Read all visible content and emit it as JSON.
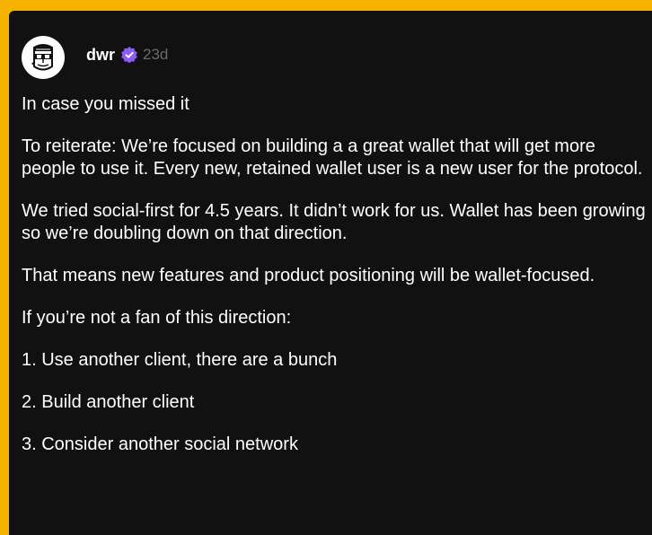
{
  "post": {
    "author": {
      "name": "dwr",
      "verified": true,
      "time": "23d"
    },
    "paragraphs": [
      "In case you missed it",
      "To reiterate: We’re focused on building a a great wallet that will get more people to use it. Every new, retained wallet user is a new user for the protocol.",
      "We tried social-first for 4.5 years. It didn’t work for us. Wallet has been growing so we’re doubling down on that direction.",
      "That means new features and product positioning will be wallet-focused.",
      "If you’re not a fan of this direction:",
      "1. Use another client, there are a bunch",
      "2. Build another client",
      "3. Consider another social network"
    ]
  },
  "colors": {
    "frame": "#f5b300",
    "card_bg": "#111111",
    "text": "#ffffff",
    "muted": "#6b6b6b",
    "verified_badge": "#8b5cf6"
  },
  "icons": {
    "avatar": "cartoon-face-avatar",
    "verified": "verified-badge-icon"
  }
}
